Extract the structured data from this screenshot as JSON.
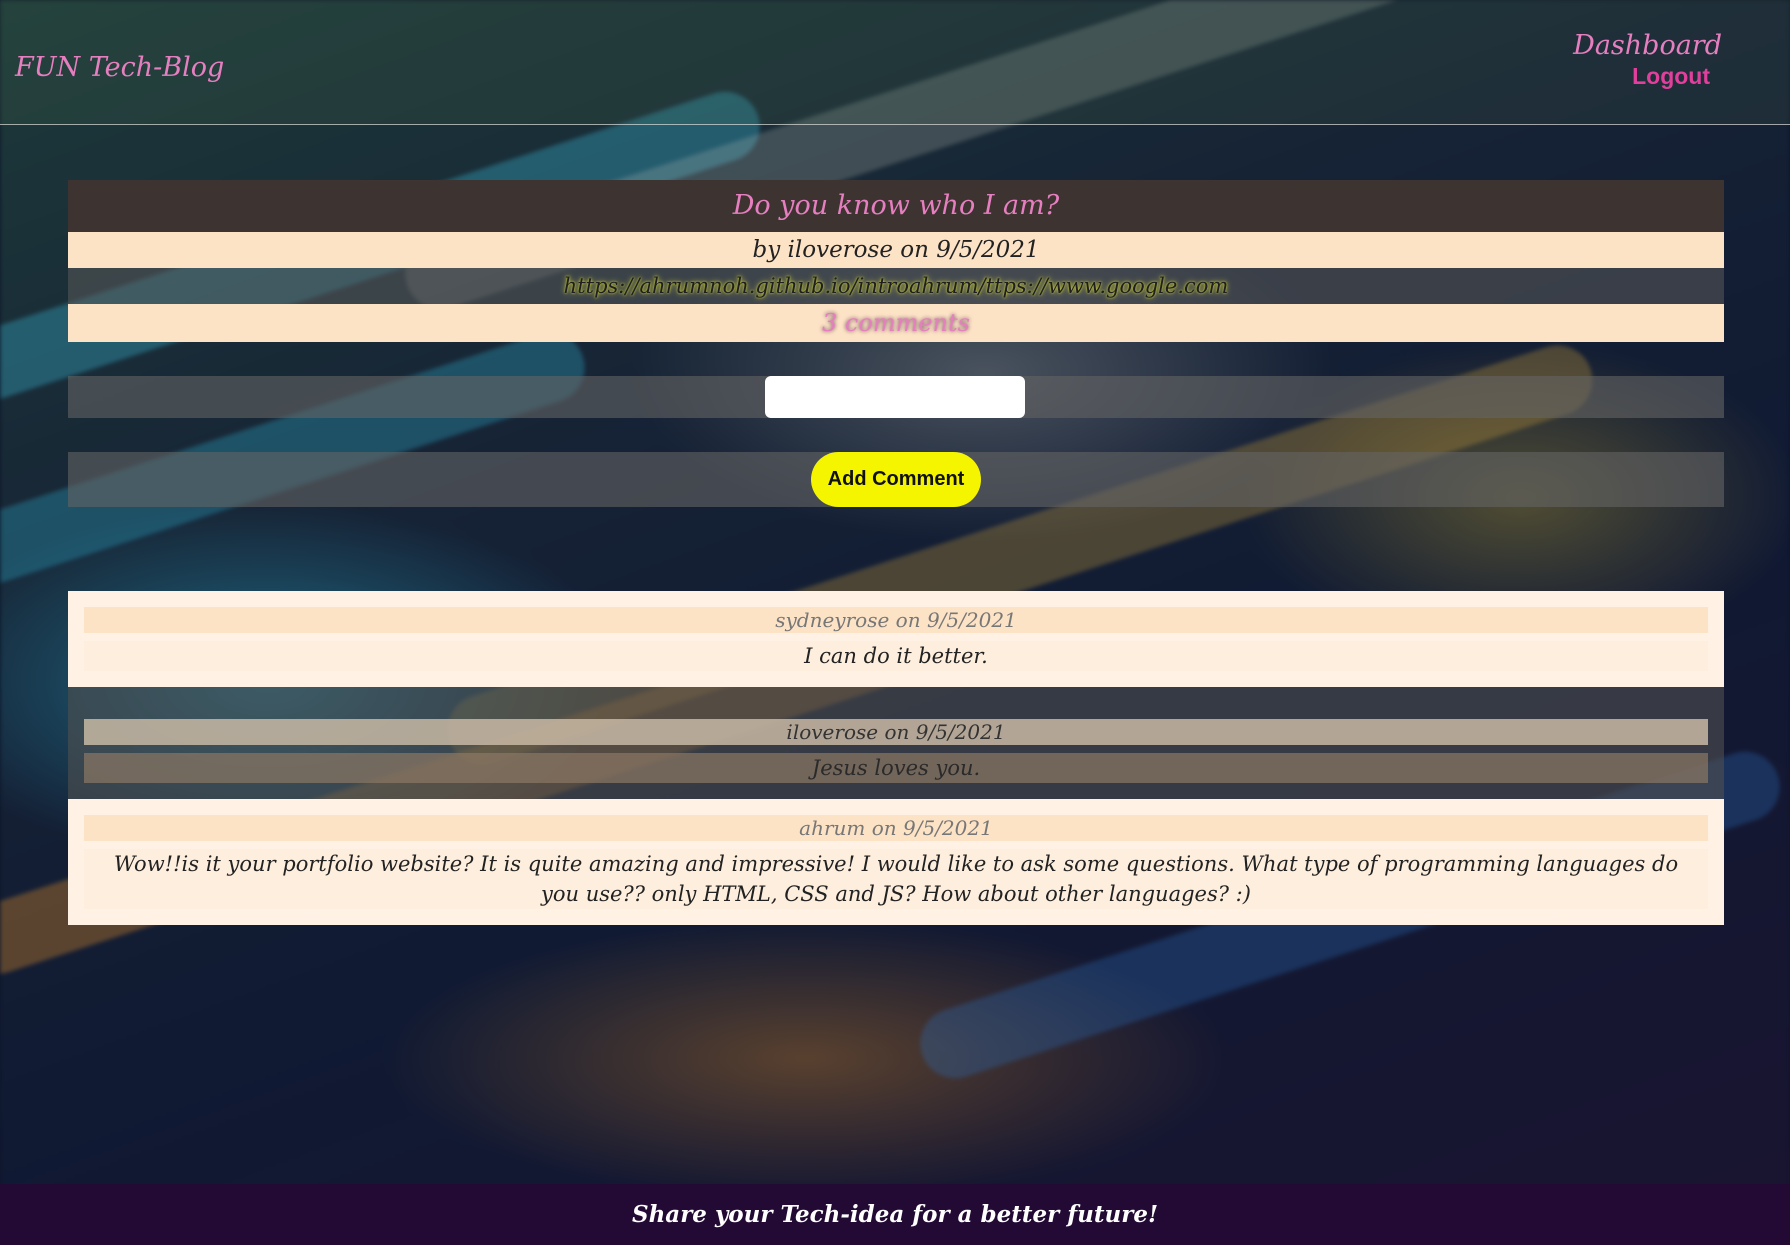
{
  "header": {
    "brand": "FUN Tech-Blog",
    "nav": {
      "dashboard": "Dashboard",
      "logout": "Logout"
    }
  },
  "post": {
    "title": "Do you know who I am?",
    "meta": "by iloverose on 9/5/2021",
    "content": "https://ahrumnoh.github.io/introahrum/ttps://www.google.com",
    "comments_count": "3 comments"
  },
  "comment_form": {
    "input_value": "",
    "submit_label": "Add Comment"
  },
  "comments": [
    {
      "meta": "sydneyrose on 9/5/2021",
      "text": "I can do it better."
    },
    {
      "meta": "iloverose on 9/5/2021",
      "text": "Jesus loves you."
    },
    {
      "meta": "ahrum on 9/5/2021",
      "text": "Wow!!is it your portfolio website? It is quite amazing and impressive! I would like to ask some questions. What type of programming languages do you use?? only HTML, CSS and JS? How about other languages? :)"
    }
  ],
  "footer": {
    "text": "Share your Tech-idea for a better future!"
  },
  "colors": {
    "accent_pink": "#e67fbf",
    "logout_pink": "#e0409c",
    "button_yellow": "#f5f500",
    "footer_bg": "#230a35",
    "title_bg": "#3d3331",
    "meta_bg": "#fde3c6"
  }
}
